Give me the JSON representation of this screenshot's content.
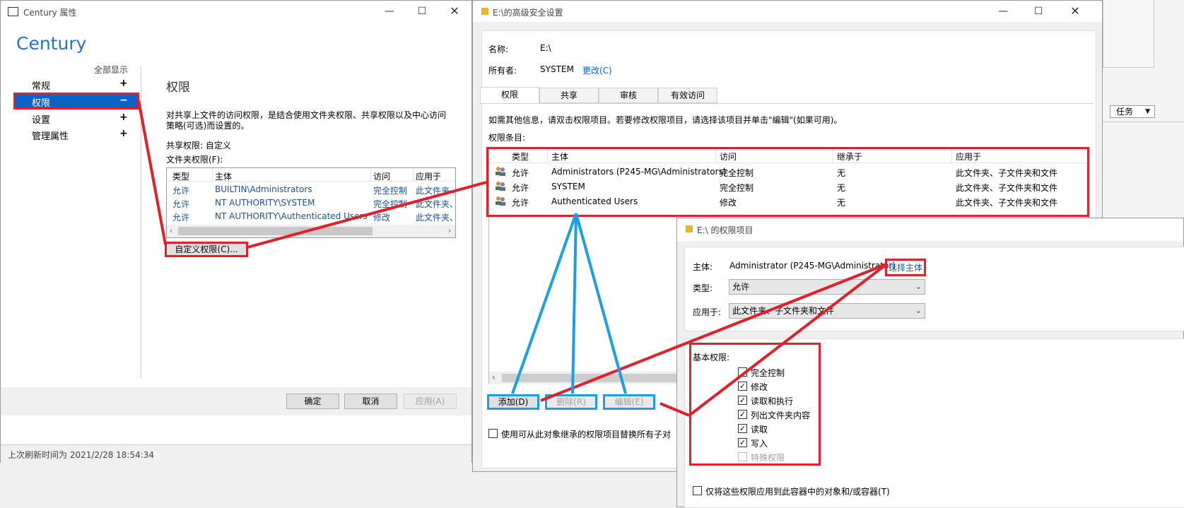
{
  "left_window": {
    "title": "Century 属性",
    "heading": "Century",
    "show_all": "全部显示",
    "nav": [
      {
        "label": "常规",
        "sign": "+"
      },
      {
        "label": "权限",
        "sign": "−"
      },
      {
        "label": "设置",
        "sign": "+"
      },
      {
        "label": "管理属性",
        "sign": "+"
      }
    ],
    "section_title": "权限",
    "description": "对共享上文件的访问权限，是结合使用文件夹权限、共享权限以及中心访问策略(可选)而设置的。",
    "share_perm": "共享权限: 自定义",
    "folder_perm": "文件夹权限(F):",
    "table_headers": [
      "类型",
      "主体",
      "访问",
      "应用于"
    ],
    "table_rows": [
      [
        "允许",
        "BUILTIN\\Administrators",
        "完全控制",
        "此文件夹..."
      ],
      [
        "允许",
        "NT AUTHORITY\\SYSTEM",
        "完全控制",
        "此文件夹、..."
      ],
      [
        "允许",
        "NT AUTHORITY\\Authenticated Users",
        "修改",
        "此文件夹、..."
      ]
    ],
    "custom_btn": "自定义权限(C)...",
    "ok": "确定",
    "cancel": "取消",
    "apply": "应用(A)",
    "status": "上次刷新时间为 2021/2/28 18:54:34"
  },
  "mid_window": {
    "title": "E:\\的高级安全设置",
    "name_label": "名称:",
    "name_value": "E:\\",
    "owner_label": "所有者:",
    "owner_value": "SYSTEM",
    "change": "更改(C)",
    "tabs": [
      "权限",
      "共享",
      "审核",
      "有效访问"
    ],
    "info": "如需其他信息，请双击权限项目。若要修改权限项目，请选择该项目并单击\"编辑\"(如果可用)。",
    "entries_label": "权限条目:",
    "table_headers": [
      "类型",
      "主体",
      "访问",
      "继承于",
      "应用于"
    ],
    "table_rows": [
      [
        "允许",
        "Administrators (P245-MG\\Administrators)",
        "完全控制",
        "无",
        "此文件夹、子文件夹和文件"
      ],
      [
        "允许",
        "SYSTEM",
        "完全控制",
        "无",
        "此文件夹、子文件夹和文件"
      ],
      [
        "允许",
        "Authenticated Users",
        "修改",
        "无",
        "此文件夹、子文件夹和文件"
      ]
    ],
    "add": "添加(D)",
    "remove": "删除(R)",
    "edit": "编辑(E)",
    "replace_cb": "使用可从此对象继承的权限项目替换所有子对"
  },
  "right_window": {
    "title": "E:\\ 的权限项目",
    "principal_label": "主体:",
    "principal_value": "Administrator (P245-MG\\Administrator)",
    "select_principal": "选择主体",
    "type_label": "类型:",
    "type_value": "允许",
    "applies_label": "应用于:",
    "applies_value": "此文件夹、子文件夹和文件",
    "basic_label": "基本权限:",
    "perms": [
      {
        "label": "完全控制",
        "checked": false,
        "disabled": false
      },
      {
        "label": "修改",
        "checked": true,
        "disabled": false
      },
      {
        "label": "读取和执行",
        "checked": true,
        "disabled": false
      },
      {
        "label": "列出文件夹内容",
        "checked": true,
        "disabled": false
      },
      {
        "label": "读取",
        "checked": true,
        "disabled": false
      },
      {
        "label": "写入",
        "checked": true,
        "disabled": false
      },
      {
        "label": "特殊权限",
        "checked": false,
        "disabled": true
      }
    ],
    "only_apply": "仅将这些权限应用到此容器中的对象和/或容器(T)"
  },
  "far_right": {
    "tasks": "任务"
  },
  "colors": {
    "highlight_red": "#e0202a",
    "highlight_blue": "#1aa0e0",
    "selected_nav": "#0a64c8"
  }
}
